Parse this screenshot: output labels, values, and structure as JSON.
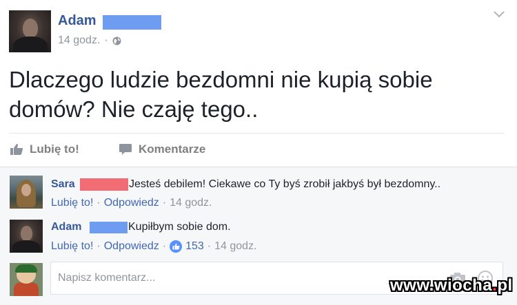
{
  "post": {
    "author": "Adam",
    "time": "14 godz.",
    "separator": "·",
    "text": "Dlaczego ludzie bezdomni nie kupią sobie domów? Nie czaję tego..",
    "icons": {
      "privacy": "globe-icon",
      "menu": "chevron-down-icon"
    }
  },
  "actions": {
    "like": "Lubię to!",
    "comment": "Komentarze"
  },
  "comments": [
    {
      "author": "Sara",
      "text": "Jesteś debilem! Ciekawe co Ty byś zrobił jakbyś był bezdomny..",
      "like": "Lubię to!",
      "reply": "Odpowiedz",
      "time": "14 godz."
    },
    {
      "author": "Adam",
      "text": "Kupiłbym sobie dom.",
      "like": "Lubię to!",
      "reply": "Odpowiedz",
      "likes_count": "153",
      "time": "14 godz."
    }
  ],
  "composer": {
    "placeholder": "Napisz komentarz...",
    "icons": [
      "camera-icon",
      "emoji-icon"
    ]
  },
  "watermark": {
    "prefix": "www.wiocha",
    "dot": ".",
    "suffix": "pl"
  },
  "colors": {
    "link": "#365899",
    "action_link": "#4267b2",
    "meta": "#90949c",
    "redaction_blue": "#6e9cf0",
    "redaction_red": "#f26d73",
    "like_badge": "#5890ff"
  }
}
